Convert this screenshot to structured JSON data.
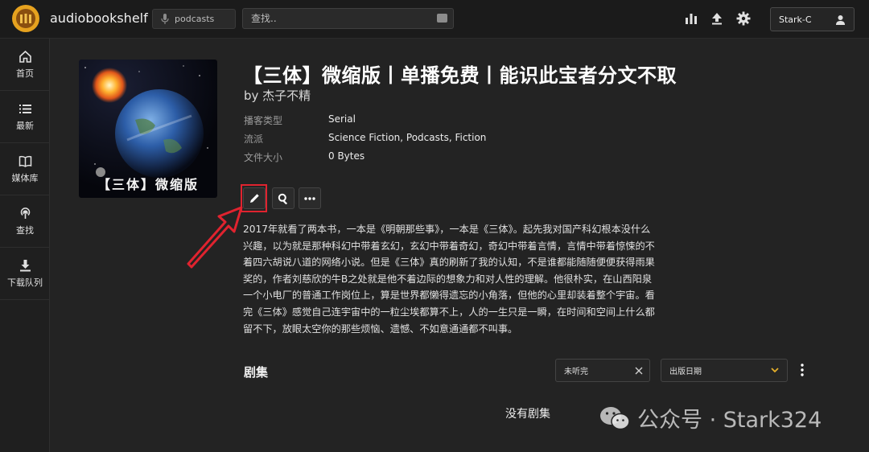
{
  "app": {
    "title": "audiobookshelf"
  },
  "header": {
    "library_name": "podcasts",
    "search_placeholder": "查找..",
    "user_name": "Stark-C"
  },
  "sidebar": {
    "items": [
      {
        "label": "首页",
        "icon": "home-icon"
      },
      {
        "label": "最新",
        "icon": "list-icon"
      },
      {
        "label": "媒体库",
        "icon": "book-open-icon"
      },
      {
        "label": "查找",
        "icon": "podcast-icon"
      },
      {
        "label": "下载队列",
        "icon": "download-icon"
      }
    ]
  },
  "podcast": {
    "cover_text": "【三体】微缩版",
    "title": "【三体】微缩版丨单播免费丨能识此宝者分文不取",
    "author": "by 杰子不精",
    "meta": [
      {
        "label": "播客类型",
        "value": "Serial"
      },
      {
        "label": "流派",
        "value": "Science Fiction, Podcasts, Fiction"
      },
      {
        "label": "文件大小",
        "value": "0 Bytes"
      }
    ],
    "description_lines": [
      "2017年就看了两本书，一本是《明朝那些事》，一本是《三体》。起先我对国产科幻根本没什么",
      "兴趣，以为就是那种科幻中带着玄幻，玄幻中带着奇幻，奇幻中带着言情，言情中带着惊悚的不",
      "着四六胡说八道的网络小说。但是《三体》真的刷新了我的认知，不是谁都能随随便便获得雨果",
      "奖的，作者刘慈欣的牛B之处就是他不着边际的想象力和对人性的理解。他很朴实，在山西阳泉",
      "一个小电厂的普通工作岗位上，算是世界都懒得遗忘的小角落，但他的心里却装着整个宇宙。看",
      "完《三体》感觉自己连宇宙中的一粒尘埃都算不上，人的一生只是一瞬，在时间和空间上什么都",
      "留不下，放眼太空你的那些烦恼、遗憾、不如意通通都不叫事。"
    ]
  },
  "episodes": {
    "section_title": "剧集",
    "filter_value": "未听完",
    "sort_value": "出版日期",
    "empty_text": "没有剧集"
  },
  "watermark": {
    "text": "公众号 · Stark324"
  },
  "colors": {
    "highlight": "#e0232f",
    "logo": "#e6a21f"
  }
}
